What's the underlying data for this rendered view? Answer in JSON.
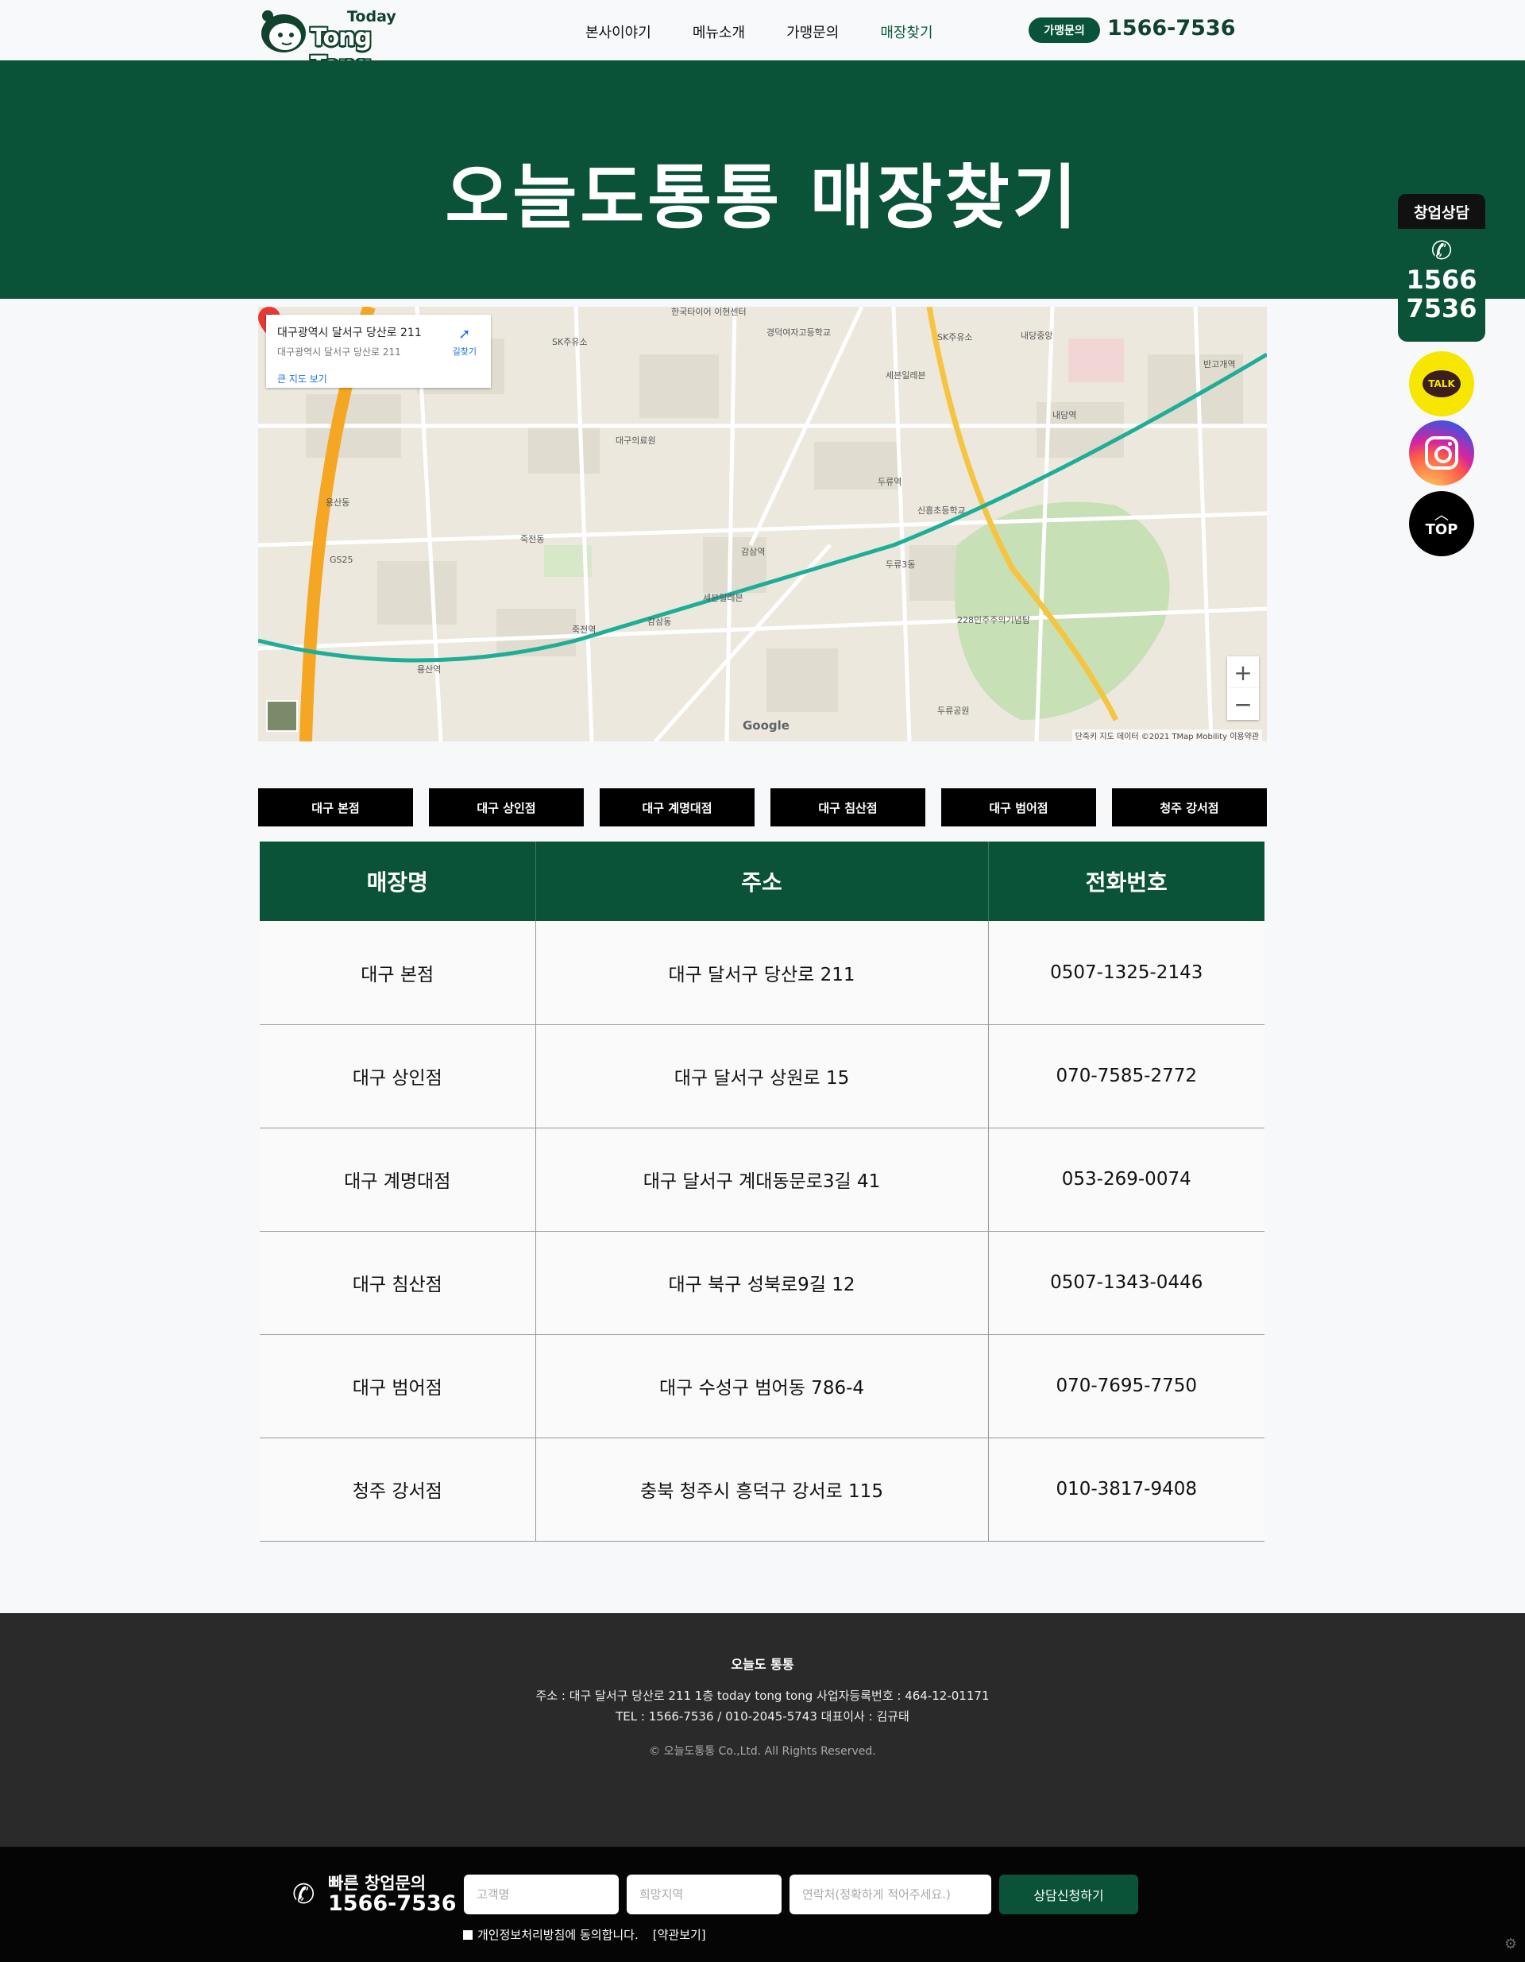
{
  "header": {
    "logo_top": "Today",
    "logo_name": "Tong Tong",
    "nav": [
      "본사이야기",
      "메뉴소개",
      "가맹문의",
      "매장찾기"
    ],
    "inquiry_badge": "가맹문의",
    "inquiry_phone": "1566-7536"
  },
  "banner": {
    "title": "오늘도통통 매장찾기"
  },
  "map": {
    "card_title": "대구광역시 달서구 당산로 211",
    "card_subtitle": "대구광역시 달서구 당산로 211",
    "card_link": "큰 지도 보기",
    "directions": "길찾기",
    "zoom_in": "+",
    "zoom_out": "−",
    "google": "Google",
    "copyright": "단축키   지도 데이터 ©2021 TMap Mobility   이용약관",
    "labels": [
      "한국타이어 이현센터",
      "경덕여자고등학교",
      "SK주유소",
      "내당중앙",
      "반고개역",
      "세븐일레븐",
      "두류역",
      "감삼역",
      "죽전역",
      "용산역",
      "228민주주의기념탑",
      "두류공원",
      "SK주유소",
      "GS25",
      "대구의료원",
      "내당역",
      "신흥초등학교",
      "세븐일레븐",
      "두류3동",
      "감삼동",
      "죽전동",
      "용산동"
    ]
  },
  "stores": {
    "buttons": [
      "대구 본점",
      "대구 상인점",
      "대구 계명대점",
      "대구 침산점",
      "대구 범어점",
      "청주 강서점"
    ],
    "headers": [
      "매장명",
      "주소",
      "전화번호"
    ],
    "rows": [
      [
        "대구 본점",
        "대구 달서구 당산로 211",
        "0507-1325-2143"
      ],
      [
        "대구 상인점",
        "대구 달서구 상원로 15",
        "070-7585-2772"
      ],
      [
        "대구 계명대점",
        "대구 달서구 계대동문로3길 41",
        "053-269-0074"
      ],
      [
        "대구 침산점",
        "대구 북구 성북로9길 12",
        "0507-1343-0446"
      ],
      [
        "대구 범어점",
        "대구 수성구 범어동 786-4",
        "070-7695-7750"
      ],
      [
        "청주 강서점",
        "충북 청주시 흥덕구 강서로 115",
        "010-3817-9408"
      ]
    ]
  },
  "footer": {
    "name": "오늘도 통통",
    "address": "주소 : 대구 달서구 당산로 211 1층 today tong tong 사업자등록번호 : 464-12-01171",
    "tel": "TEL : 1566-7536 / 010-2045-5743 대표이사 : 김규태",
    "copyright": "© 오늘도통통 Co.,Ltd. All Rights Reserved."
  },
  "bottom_bar": {
    "title": "빠른 창업문의",
    "phone": "1566-7536",
    "name_placeholder": "고객명",
    "area_placeholder": "희망지역",
    "contact_placeholder": "연락처(정확하게 적어주세요.)",
    "submit": "상담신청하기",
    "agree": "개인정보처리방침에 동의합니다.",
    "terms": "[약관보기]"
  },
  "side": {
    "consult_tab": "창업상담",
    "consult_num1": "1566",
    "consult_num2": "7536",
    "talk": "TALK",
    "top": "TOP"
  },
  "colors": {
    "brand_green": "#0a5238",
    "footer_bg": "#2a2a2a",
    "bar_bg": "#050505"
  }
}
